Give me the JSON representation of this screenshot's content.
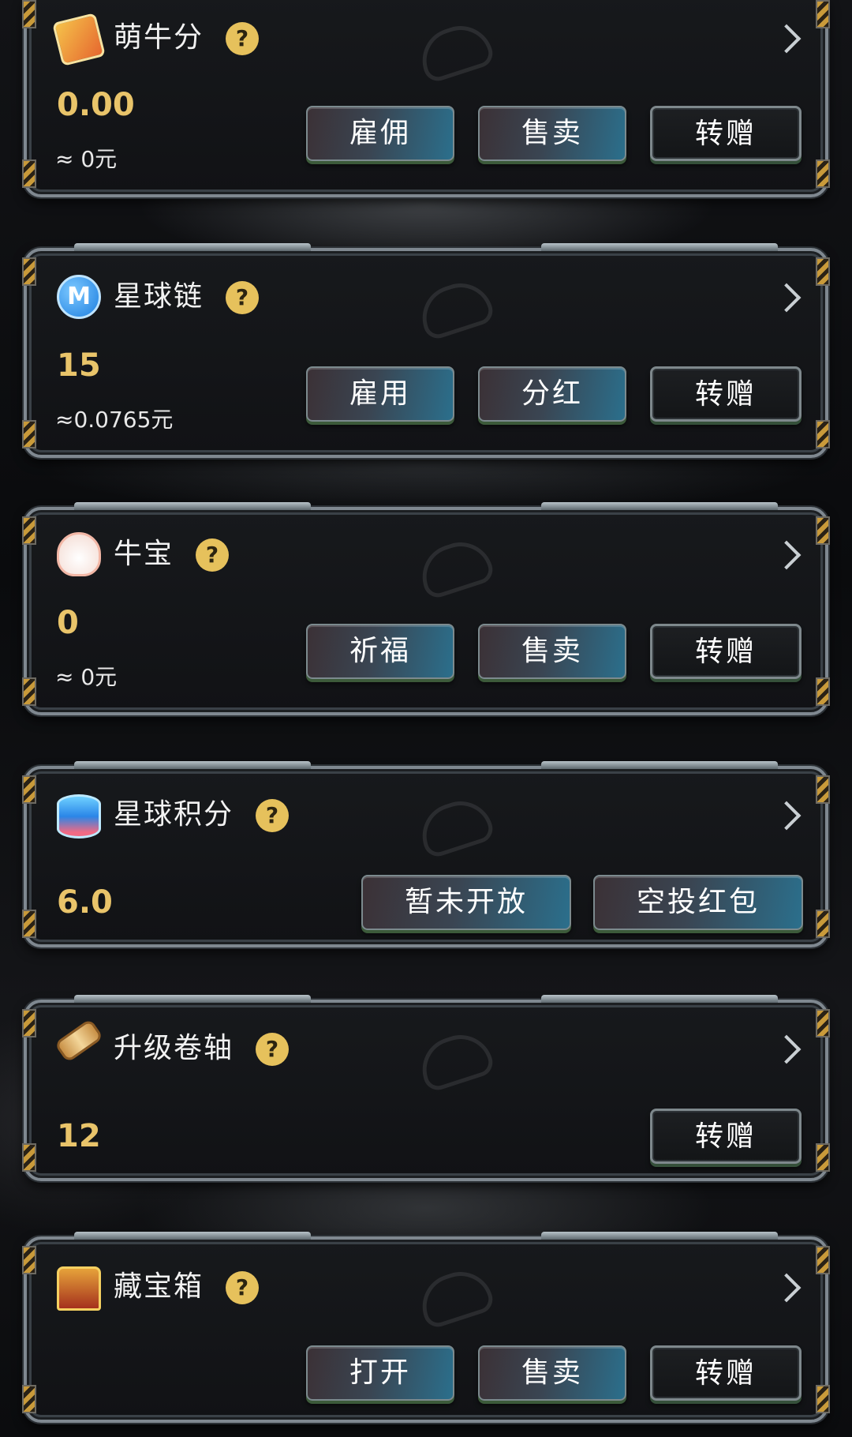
{
  "cards": [
    {
      "title": "萌牛分",
      "icon": "ticket-icon",
      "help": "?",
      "amount": "0.00",
      "fiat": "≈ 0元",
      "buttons": [
        "雇佣",
        "售卖",
        "转赠"
      ]
    },
    {
      "title": "星球链",
      "icon": "coin-m-icon",
      "icon_glyph": "M",
      "help": "?",
      "amount": "15",
      "fiat": "≈0.0765元",
      "buttons": [
        "雇用",
        "分红",
        "转赠"
      ]
    },
    {
      "title": "牛宝",
      "icon": "cow-icon",
      "help": "?",
      "amount": "0",
      "fiat": "≈ 0元",
      "buttons": [
        "祈福",
        "售卖",
        "转赠"
      ]
    },
    {
      "title": "星球积分",
      "icon": "database-icon",
      "help": "?",
      "amount": "6.0",
      "buttons": [
        "暂未开放",
        "空投红包"
      ]
    },
    {
      "title": "升级卷轴",
      "icon": "scroll-icon",
      "help": "?",
      "amount": "12",
      "buttons": [
        "转赠"
      ]
    },
    {
      "title": "藏宝箱",
      "icon": "treasure-chest-icon",
      "help": "?",
      "buttons": [
        "打开",
        "售卖",
        "转赠"
      ]
    }
  ],
  "colors": {
    "amount": "#e9c46a",
    "help_badge": "#e6c15c",
    "button_accent": "#2b6f8c"
  }
}
